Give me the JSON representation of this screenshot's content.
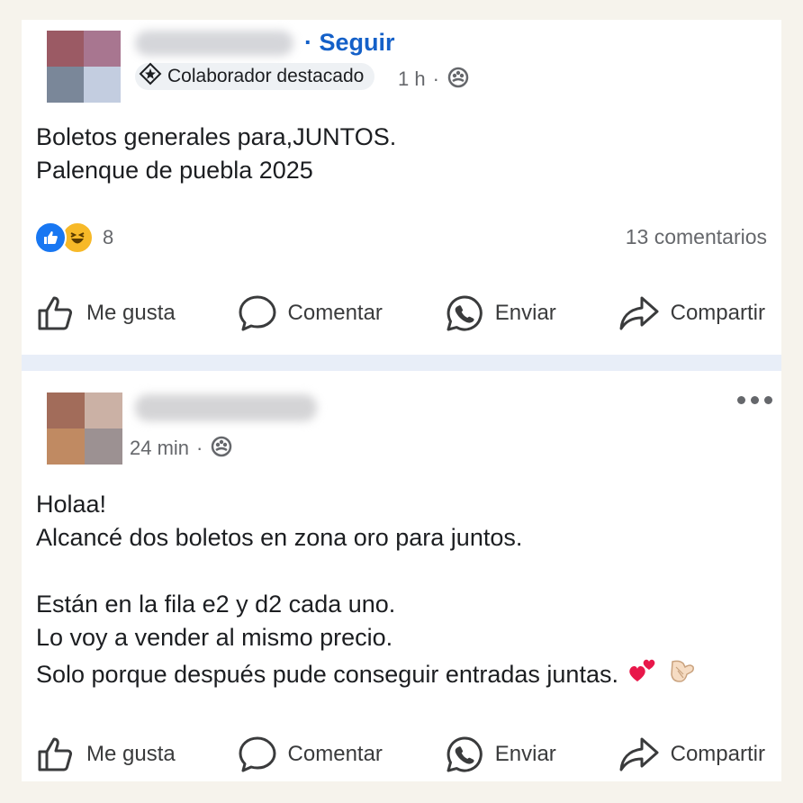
{
  "post1": {
    "follow_label": "· Seguir",
    "badge_label": "Colaborador destacado",
    "time": "1 h",
    "separator": "·",
    "text_lines": [
      "Boletos generales para,JUNTOS.",
      "Palenque de puebla 2025"
    ],
    "reactions_count": "8",
    "comments_count": "13 comentarios",
    "actions": {
      "like": "Me gusta",
      "comment": "Comentar",
      "send": "Enviar",
      "share": "Compartir"
    }
  },
  "post2": {
    "time": "24 min",
    "separator": "·",
    "text_lines": [
      "Holaa!",
      "Alcancé dos boletos en zona oro para juntos.",
      "",
      "Están en la fila e2 y d2 cada uno.",
      "Lo voy a vender al mismo precio.",
      "Solo porque después pude conseguir entradas juntas."
    ],
    "emoji_tail": [
      "two-hearts-icon",
      "pointing-hand-icon"
    ],
    "actions": {
      "like": "Me gusta",
      "comment": "Comentar",
      "send": "Enviar",
      "share": "Compartir"
    }
  },
  "icons": {
    "audience": "friends-icon",
    "badge": "star-badge-icon",
    "logo": "pink-c-logo-icon"
  },
  "colors": {
    "follow": "#1460c8",
    "like_reaction": "#1877f2",
    "haha_reaction": "#f7b928",
    "logo": "#ec2c8e",
    "divider": "#e8eef8",
    "background": "#f6f3ec"
  }
}
